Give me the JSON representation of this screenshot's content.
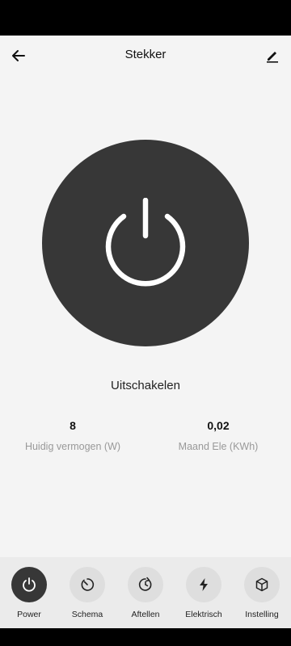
{
  "header": {
    "title": "Stekker"
  },
  "power": {
    "state_label": "Uitschakelen"
  },
  "metrics": [
    {
      "value": "8",
      "label": "Huidig vermogen (W)"
    },
    {
      "value": "0,02",
      "label": "Maand Ele (KWh)"
    }
  ],
  "nav": {
    "items": [
      {
        "label": "Power",
        "icon": "power-icon",
        "active": true
      },
      {
        "label": "Schema",
        "icon": "schedule-icon",
        "active": false
      },
      {
        "label": "Aftellen",
        "icon": "countdown-icon",
        "active": false
      },
      {
        "label": "Elektrisch",
        "icon": "lightning-icon",
        "active": false
      },
      {
        "label": "Instelling",
        "icon": "cube-icon",
        "active": false
      }
    ]
  },
  "colors": {
    "dark": "#373737",
    "background": "#f4f4f4",
    "nav_background": "#ebebeb",
    "nav_circle": "#dedede"
  }
}
